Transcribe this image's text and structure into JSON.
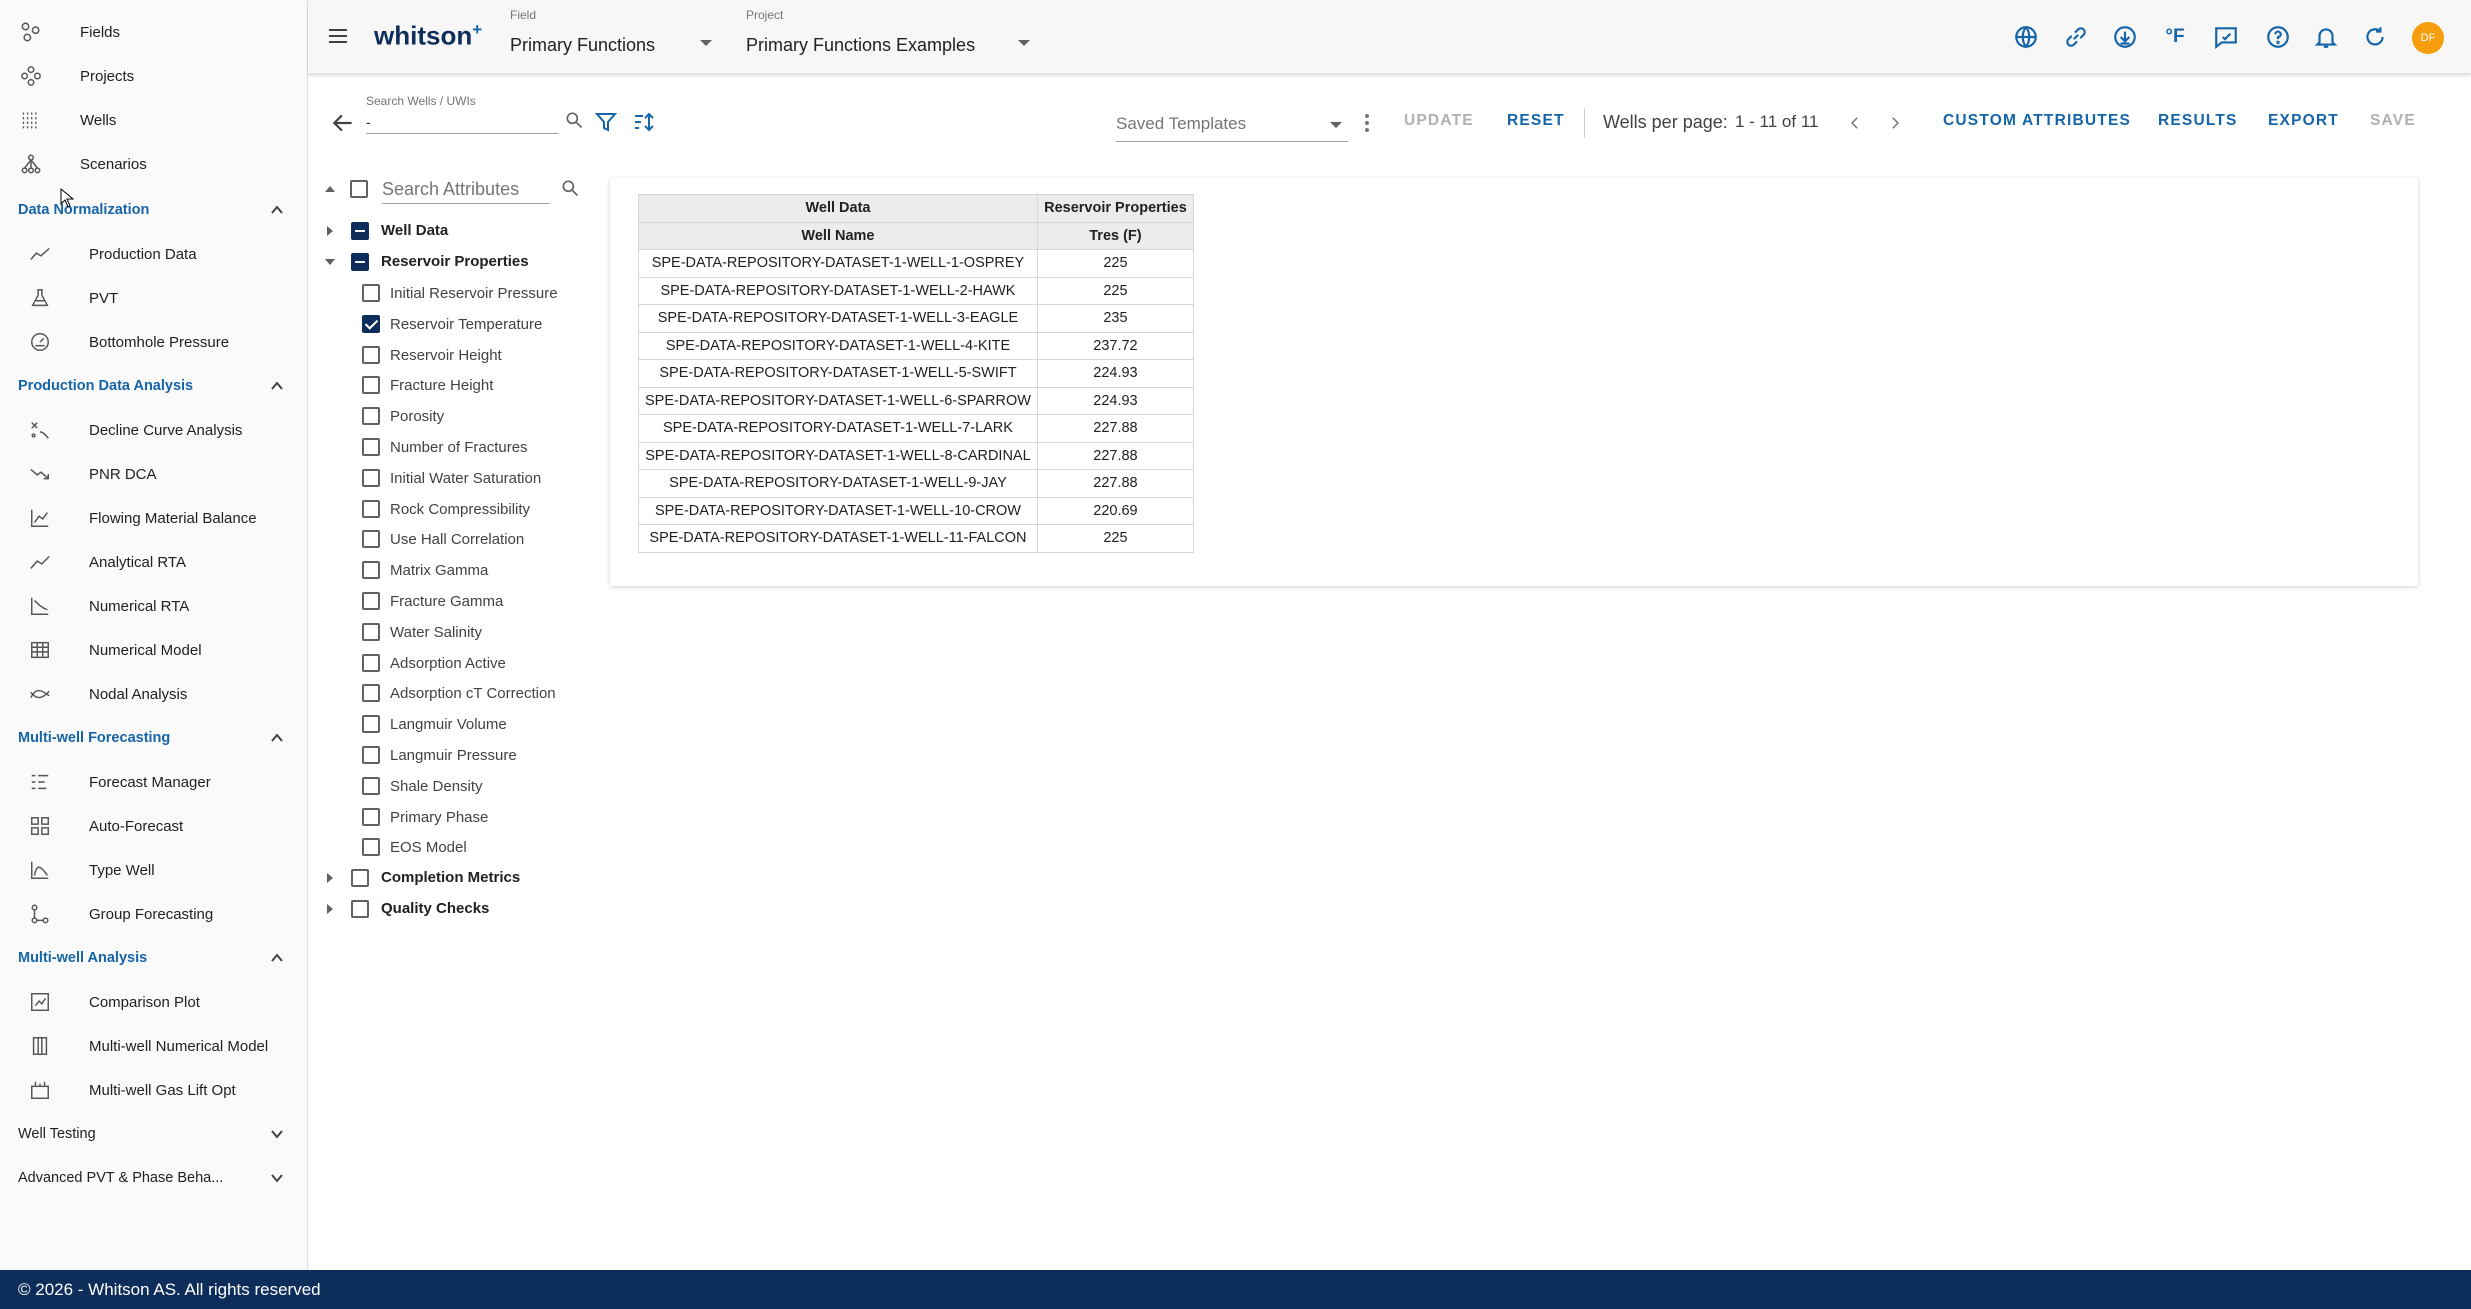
{
  "sidebar": {
    "top_items": [
      {
        "label": "Fields",
        "icon": "fields-icon"
      },
      {
        "label": "Projects",
        "icon": "projects-icon"
      },
      {
        "label": "Wells",
        "icon": "wells-icon"
      },
      {
        "label": "Scenarios",
        "icon": "scenarios-icon"
      }
    ],
    "sections": [
      {
        "title": "Data Normalization",
        "expanded": true,
        "items": [
          {
            "label": "Production Data",
            "icon": "production-data-icon"
          },
          {
            "label": "PVT",
            "icon": "pvt-flask-icon"
          },
          {
            "label": "Bottomhole Pressure",
            "icon": "gauge-icon"
          }
        ]
      },
      {
        "title": "Production Data Analysis",
        "expanded": true,
        "items": [
          {
            "label": "Decline Curve Analysis",
            "icon": "decline-curve-icon"
          },
          {
            "label": "PNR DCA",
            "icon": "trend-down-icon"
          },
          {
            "label": "Flowing Material Balance",
            "icon": "material-balance-icon"
          },
          {
            "label": "Analytical RTA",
            "icon": "analytical-rta-icon"
          },
          {
            "label": "Numerical RTA",
            "icon": "numerical-rta-icon"
          },
          {
            "label": "Numerical Model",
            "icon": "numerical-model-icon"
          },
          {
            "label": "Nodal Analysis",
            "icon": "nodal-analysis-icon"
          }
        ]
      },
      {
        "title": "Multi-well Forecasting",
        "expanded": true,
        "items": [
          {
            "label": "Forecast Manager",
            "icon": "forecast-manager-icon"
          },
          {
            "label": "Auto-Forecast",
            "icon": "auto-forecast-icon"
          },
          {
            "label": "Type Well",
            "icon": "type-well-icon"
          },
          {
            "label": "Group Forecasting",
            "icon": "group-forecasting-icon"
          }
        ]
      },
      {
        "title": "Multi-well Analysis",
        "expanded": true,
        "items": [
          {
            "label": "Comparison Plot",
            "icon": "comparison-plot-icon"
          },
          {
            "label": "Multi-well Numerical Model",
            "icon": "multiwell-model-icon"
          },
          {
            "label": "Multi-well Gas Lift Opt",
            "icon": "gas-lift-icon"
          }
        ]
      },
      {
        "title": "Well Testing",
        "expanded": false,
        "items": []
      },
      {
        "title": "Advanced PVT & Phase Beha...",
        "expanded": false,
        "items": []
      }
    ]
  },
  "header": {
    "logo": "whitson",
    "logo_sup": "+",
    "field": {
      "caption": "Field",
      "value": "Primary Functions"
    },
    "project": {
      "caption": "Project",
      "value": "Primary Functions Examples"
    },
    "icons": [
      "globe-icon",
      "link-icon",
      "download-icon",
      "temperature-unit-icon",
      "feedback-icon",
      "help-icon",
      "bell-icon",
      "refresh-icon"
    ],
    "unit_label": "°F",
    "avatar_initials": "DF",
    "accent": "#1565a8",
    "brand_dark": "#0d2d5a",
    "avatar_color": "#f59d0b"
  },
  "toolbar": {
    "search_caption": "Search Wells / UWIs",
    "search_value": "-",
    "saved_templates": "Saved Templates",
    "update": "UPDATE",
    "reset": "RESET",
    "wells_per_page": "Wells per page:",
    "page_count": "1 - 11 of 11",
    "custom_attributes": "CUSTOM ATTRIBUTES",
    "results": "RESULTS",
    "export": "EXPORT",
    "save": "SAVE"
  },
  "attributes": {
    "search_placeholder": "Search Attributes",
    "groups": [
      {
        "label": "Well Data",
        "state": "indeterminate",
        "expanded": false
      },
      {
        "label": "Reservoir Properties",
        "state": "indeterminate",
        "expanded": true,
        "children": [
          {
            "label": "Initial Reservoir Pressure",
            "checked": false
          },
          {
            "label": "Reservoir Temperature",
            "checked": true
          },
          {
            "label": "Reservoir Height",
            "checked": false
          },
          {
            "label": "Fracture Height",
            "checked": false
          },
          {
            "label": "Porosity",
            "checked": false
          },
          {
            "label": "Number of Fractures",
            "checked": false
          },
          {
            "label": "Initial Water Saturation",
            "checked": false
          },
          {
            "label": "Rock Compressibility",
            "checked": false
          },
          {
            "label": "Use Hall Correlation",
            "checked": false
          },
          {
            "label": "Matrix Gamma",
            "checked": false
          },
          {
            "label": "Fracture Gamma",
            "checked": false
          },
          {
            "label": "Water Salinity",
            "checked": false
          },
          {
            "label": "Adsorption Active",
            "checked": false
          },
          {
            "label": "Adsorption cT Correction",
            "checked": false
          },
          {
            "label": "Langmuir Volume",
            "checked": false
          },
          {
            "label": "Langmuir Pressure",
            "checked": false
          },
          {
            "label": "Shale Density",
            "checked": false
          },
          {
            "label": "Primary Phase",
            "checked": false
          },
          {
            "label": "EOS Model",
            "checked": false
          }
        ]
      },
      {
        "label": "Completion Metrics",
        "state": "unchecked",
        "expanded": false
      },
      {
        "label": "Quality Checks",
        "state": "unchecked",
        "expanded": false
      }
    ]
  },
  "table": {
    "group_headers": [
      "Well Data",
      "Reservoir Properties"
    ],
    "columns": [
      "Well Name",
      "Tres (F)"
    ],
    "rows": [
      [
        "SPE-DATA-REPOSITORY-DATASET-1-WELL-1-OSPREY",
        "225"
      ],
      [
        "SPE-DATA-REPOSITORY-DATASET-1-WELL-2-HAWK",
        "225"
      ],
      [
        "SPE-DATA-REPOSITORY-DATASET-1-WELL-3-EAGLE",
        "235"
      ],
      [
        "SPE-DATA-REPOSITORY-DATASET-1-WELL-4-KITE",
        "237.72"
      ],
      [
        "SPE-DATA-REPOSITORY-DATASET-1-WELL-5-SWIFT",
        "224.93"
      ],
      [
        "SPE-DATA-REPOSITORY-DATASET-1-WELL-6-SPARROW",
        "224.93"
      ],
      [
        "SPE-DATA-REPOSITORY-DATASET-1-WELL-7-LARK",
        "227.88"
      ],
      [
        "SPE-DATA-REPOSITORY-DATASET-1-WELL-8-CARDINAL",
        "227.88"
      ],
      [
        "SPE-DATA-REPOSITORY-DATASET-1-WELL-9-JAY",
        "227.88"
      ],
      [
        "SPE-DATA-REPOSITORY-DATASET-1-WELL-10-CROW",
        "220.69"
      ],
      [
        "SPE-DATA-REPOSITORY-DATASET-1-WELL-11-FALCON",
        "225"
      ]
    ]
  },
  "footer": {
    "text": "© 2026 - Whitson AS. All rights reserved"
  }
}
